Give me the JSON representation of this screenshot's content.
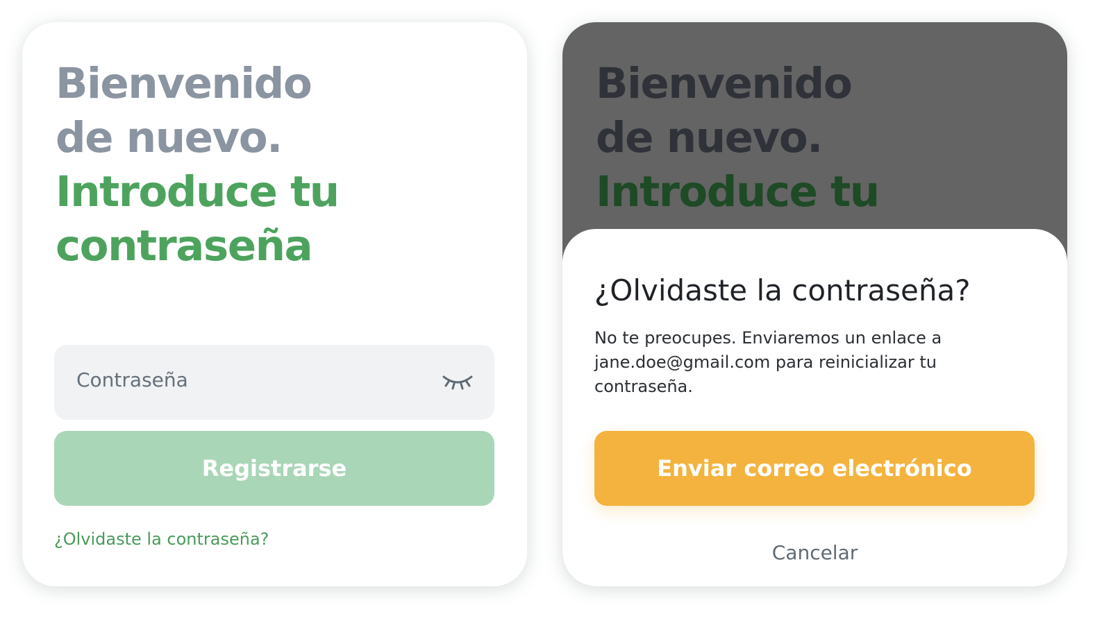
{
  "login_screen": {
    "heading": {
      "line1": "Bienvenido",
      "line2": "de nuevo.",
      "line3": "Introduce tu",
      "line4": "contraseña"
    },
    "password_field": {
      "placeholder": "Contraseña",
      "icon": "eye-closed-icon"
    },
    "register_button": "Registrarse",
    "forgot_link": "¿Olvidaste la contraseña?"
  },
  "reset_screen": {
    "heading": {
      "line1": "Bienvenido",
      "line2": "de nuevo.",
      "line3": "Introduce tu"
    },
    "sheet": {
      "title": "¿Olvidaste la contraseña?",
      "body": "No te preocupes. Enviaremos un enlace a jane.doe@gmail.com para reinicializar tu contraseña.",
      "send_button": "Enviar correo electrónico",
      "cancel": "Cancelar"
    }
  },
  "colors": {
    "muted_heading": "#8b94a1",
    "accent_green": "#4da35e",
    "register_button_disabled": "#a9d6b7",
    "send_button": "#f3b33e",
    "field_background": "#f0f2f4",
    "overlay": "#646464"
  }
}
